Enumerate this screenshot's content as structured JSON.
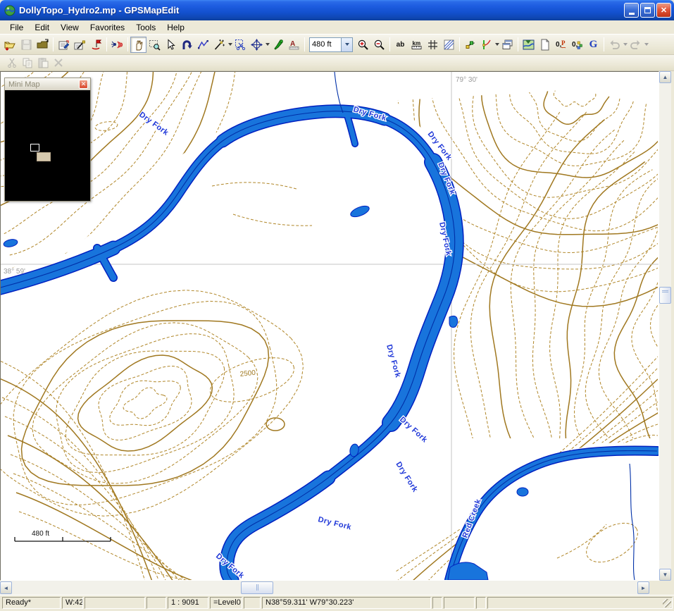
{
  "window": {
    "title": "DollyTopo_Hydro2.mp - GPSMapEdit",
    "app_icon": "gpsmapedit-globe-icon",
    "controls": [
      "minimize",
      "maximize",
      "close"
    ]
  },
  "menu": {
    "items": [
      "File",
      "Edit",
      "View",
      "Favorites",
      "Tools",
      "Help"
    ]
  },
  "toolbar": {
    "scale_value": "480 ft",
    "glyphs": {
      "ab": "ab",
      "km": "km",
      "google_g": "G",
      "zero_p": "0,P",
      "zero_colors": "0,"
    },
    "icons": [
      "open-file-icon",
      "save-icon",
      "close-folder-icon",
      "properties-icon",
      "map-wizard-icon",
      "waypoint-flag-icon",
      "gps-signal-icon",
      "pan-hand-icon",
      "zoom-select-icon",
      "pointer-icon",
      "uturn-arrow-icon",
      "polyline-icon",
      "magic-wand-icon",
      "clip-region-icon",
      "move-node-icon",
      "attach-pin-icon",
      "label-ruler-icon",
      "zoom-in-icon",
      "zoom-out-icon",
      "labels-ab-icon",
      "units-km-icon",
      "grid-icon",
      "hatch-icon",
      "edit-nodes-icon",
      "bend-line-icon",
      "cascade-windows-icon",
      "map-image-icon",
      "blank-page-icon",
      "address-0p-icon",
      "levels-0-icon",
      "google-g-icon",
      "undo-icon",
      "redo-icon",
      "cut-icon",
      "copy-icon",
      "paste-icon",
      "delete-icon"
    ]
  },
  "minimap": {
    "title": "Mini Map"
  },
  "map": {
    "grid_labels": {
      "lon": "79° 30'",
      "lat": "38° 59'"
    },
    "river_labels": [
      "Dry Fork",
      "Dry Fork",
      "Dry Fork",
      "Dry Fork",
      "Dry Fork",
      "Dry Fork",
      "Dry Fork",
      "Dry Fork",
      "Dry Fork",
      "Dry Fork",
      "Red Creek"
    ],
    "contour_label": "2500",
    "scale_bar_label": "480 ft",
    "colors": {
      "river_fill": "#1874DC",
      "river_outline": "#0020C0",
      "river_centerline": "#0030A8",
      "contour_index": "#A07820",
      "contour_intermediate": "#B08628",
      "label_blue": "#2038D8",
      "grid_gray": "#C6C6C6",
      "background": "#FFFFFF"
    }
  },
  "status_bar": {
    "panels": [
      "Ready*",
      "W:42",
      "",
      "",
      "1 : 9091",
      "=Level0",
      "",
      "N38°59.311' W79°30.223'",
      "",
      "",
      ""
    ]
  }
}
